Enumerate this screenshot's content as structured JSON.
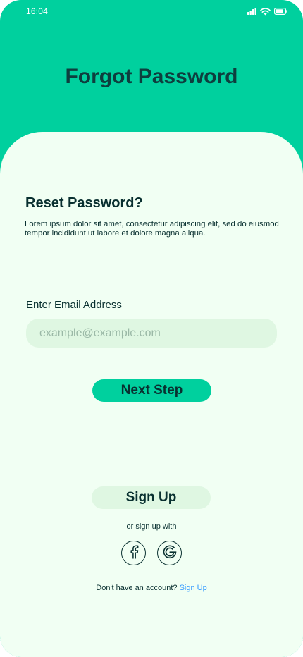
{
  "status_bar": {
    "time": "16:04",
    "icons": [
      "signal-icon",
      "wifi-icon",
      "battery-icon"
    ]
  },
  "header": {
    "title": "Forgot Password"
  },
  "reset": {
    "heading": "Reset Password?",
    "description": "Lorem ipsum dolor sit amet, consectetur adipiscing elit, sed do eiusmod tempor incididunt ut labore et dolore magna aliqua."
  },
  "email": {
    "label": "Enter Email Address",
    "placeholder": "example@example.com",
    "value": ""
  },
  "actions": {
    "next_label": "Next Step",
    "signup_label": "Sign Up"
  },
  "social": {
    "or_text": "or sign up with",
    "providers": [
      "facebook-icon",
      "google-icon"
    ]
  },
  "footer": {
    "account_text": "Don't have an account?",
    "link_label": "Sign Up"
  },
  "colors": {
    "primary": "#00D09E",
    "background": "#F1FFF3",
    "input_bg": "#DFF7E2",
    "text_dark": "#093030",
    "link": "#3299FF"
  }
}
